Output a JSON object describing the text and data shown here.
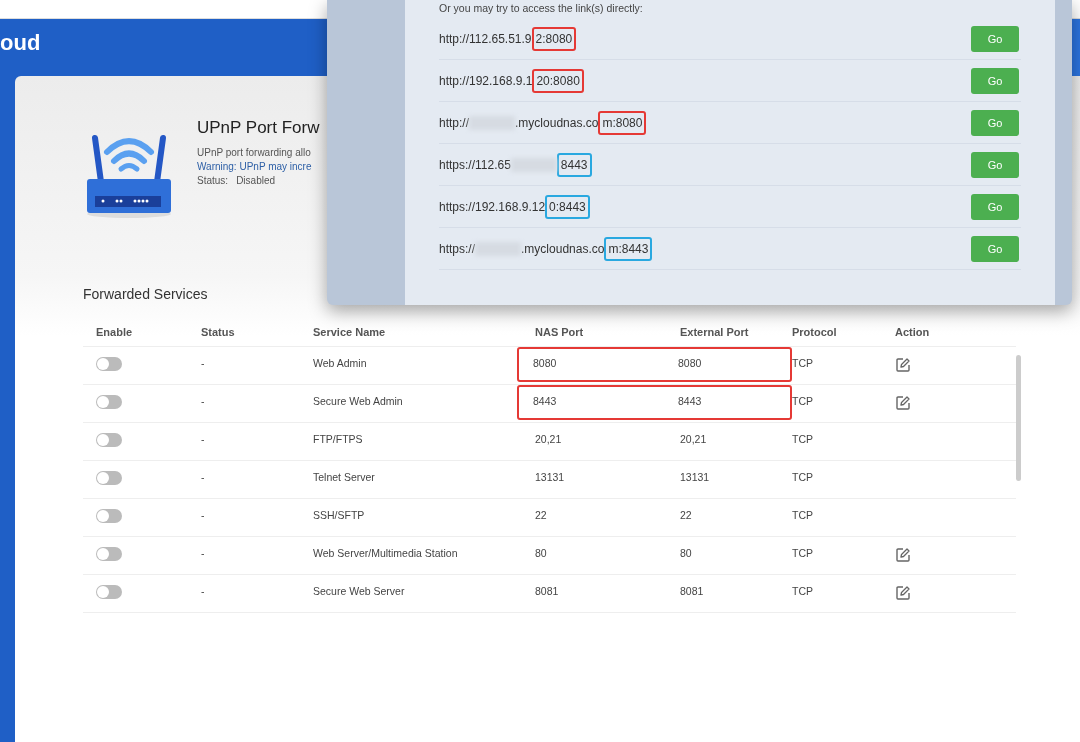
{
  "header": {
    "brand": "oud"
  },
  "upnp": {
    "title": "UPnP Port Forw",
    "description": "UPnP port forwarding allo",
    "warning": "Warning: UPnP may incre",
    "status_label": "Status:",
    "status_value": "Disabled"
  },
  "dialog": {
    "intro": "Or you may try to access the link(s) directly:",
    "links": [
      {
        "segments": [
          {
            "kind": "text",
            "text": "http://112.65.51.9"
          },
          {
            "kind": "marked",
            "text": "2:8080",
            "color": "#e53935"
          }
        ],
        "button": "Go"
      },
      {
        "segments": [
          {
            "kind": "text",
            "text": "http://192.168.9.1"
          },
          {
            "kind": "marked",
            "text": "20:8080",
            "color": "#e53935"
          }
        ],
        "button": "Go"
      },
      {
        "segments": [
          {
            "kind": "text",
            "text": "http://"
          },
          {
            "kind": "blur"
          },
          {
            "kind": "text",
            "text": ".mycloudnas.co"
          },
          {
            "kind": "marked",
            "text": "m:8080",
            "color": "#e53935"
          }
        ],
        "button": "Go"
      },
      {
        "segments": [
          {
            "kind": "text",
            "text": "https://112.65"
          },
          {
            "kind": "blur"
          },
          {
            "kind": "marked",
            "text": "8443",
            "color": "#29a8e0"
          }
        ],
        "button": "Go"
      },
      {
        "segments": [
          {
            "kind": "text",
            "text": "https://192.168.9.12"
          },
          {
            "kind": "marked",
            "text": "0:8443",
            "color": "#29a8e0"
          }
        ],
        "button": "Go"
      },
      {
        "segments": [
          {
            "kind": "text",
            "text": "https://"
          },
          {
            "kind": "blur"
          },
          {
            "kind": "text",
            "text": ".mycloudnas.co"
          },
          {
            "kind": "marked",
            "text": "m:8443",
            "color": "#29a8e0"
          }
        ],
        "button": "Go"
      }
    ]
  },
  "services": {
    "title": "Forwarded Services",
    "columns": [
      "Enable",
      "Status",
      "Service Name",
      "NAS Port",
      "External Port",
      "Protocol",
      "Action"
    ],
    "rows": [
      {
        "enabled": false,
        "status": "-",
        "name": "Web Admin",
        "nas_port": "8080",
        "external_port": "8080",
        "protocol": "TCP",
        "editable": true,
        "color": "#e53935"
      },
      {
        "enabled": false,
        "status": "-",
        "name": "Secure Web Admin",
        "nas_port": "8443",
        "external_port": "8443",
        "protocol": "TCP",
        "editable": true,
        "color": "#e53935"
      },
      {
        "enabled": false,
        "status": "-",
        "name": "FTP/FTPS",
        "nas_port": "20,21",
        "external_port": "20,21",
        "protocol": "TCP",
        "editable": false
      },
      {
        "enabled": false,
        "status": "-",
        "name": "Telnet Server",
        "nas_port": "13131",
        "external_port": "13131",
        "protocol": "TCP",
        "editable": false
      },
      {
        "enabled": false,
        "status": "-",
        "name": "SSH/SFTP",
        "nas_port": "22",
        "external_port": "22",
        "protocol": "TCP",
        "editable": false
      },
      {
        "enabled": false,
        "status": "-",
        "name": "Web Server/Multimedia Station",
        "nas_port": "80",
        "external_port": "80",
        "protocol": "TCP",
        "editable": true
      },
      {
        "enabled": false,
        "status": "-",
        "name": "Secure Web Server",
        "nas_port": "8081",
        "external_port": "8081",
        "protocol": "TCP",
        "editable": true
      }
    ]
  }
}
